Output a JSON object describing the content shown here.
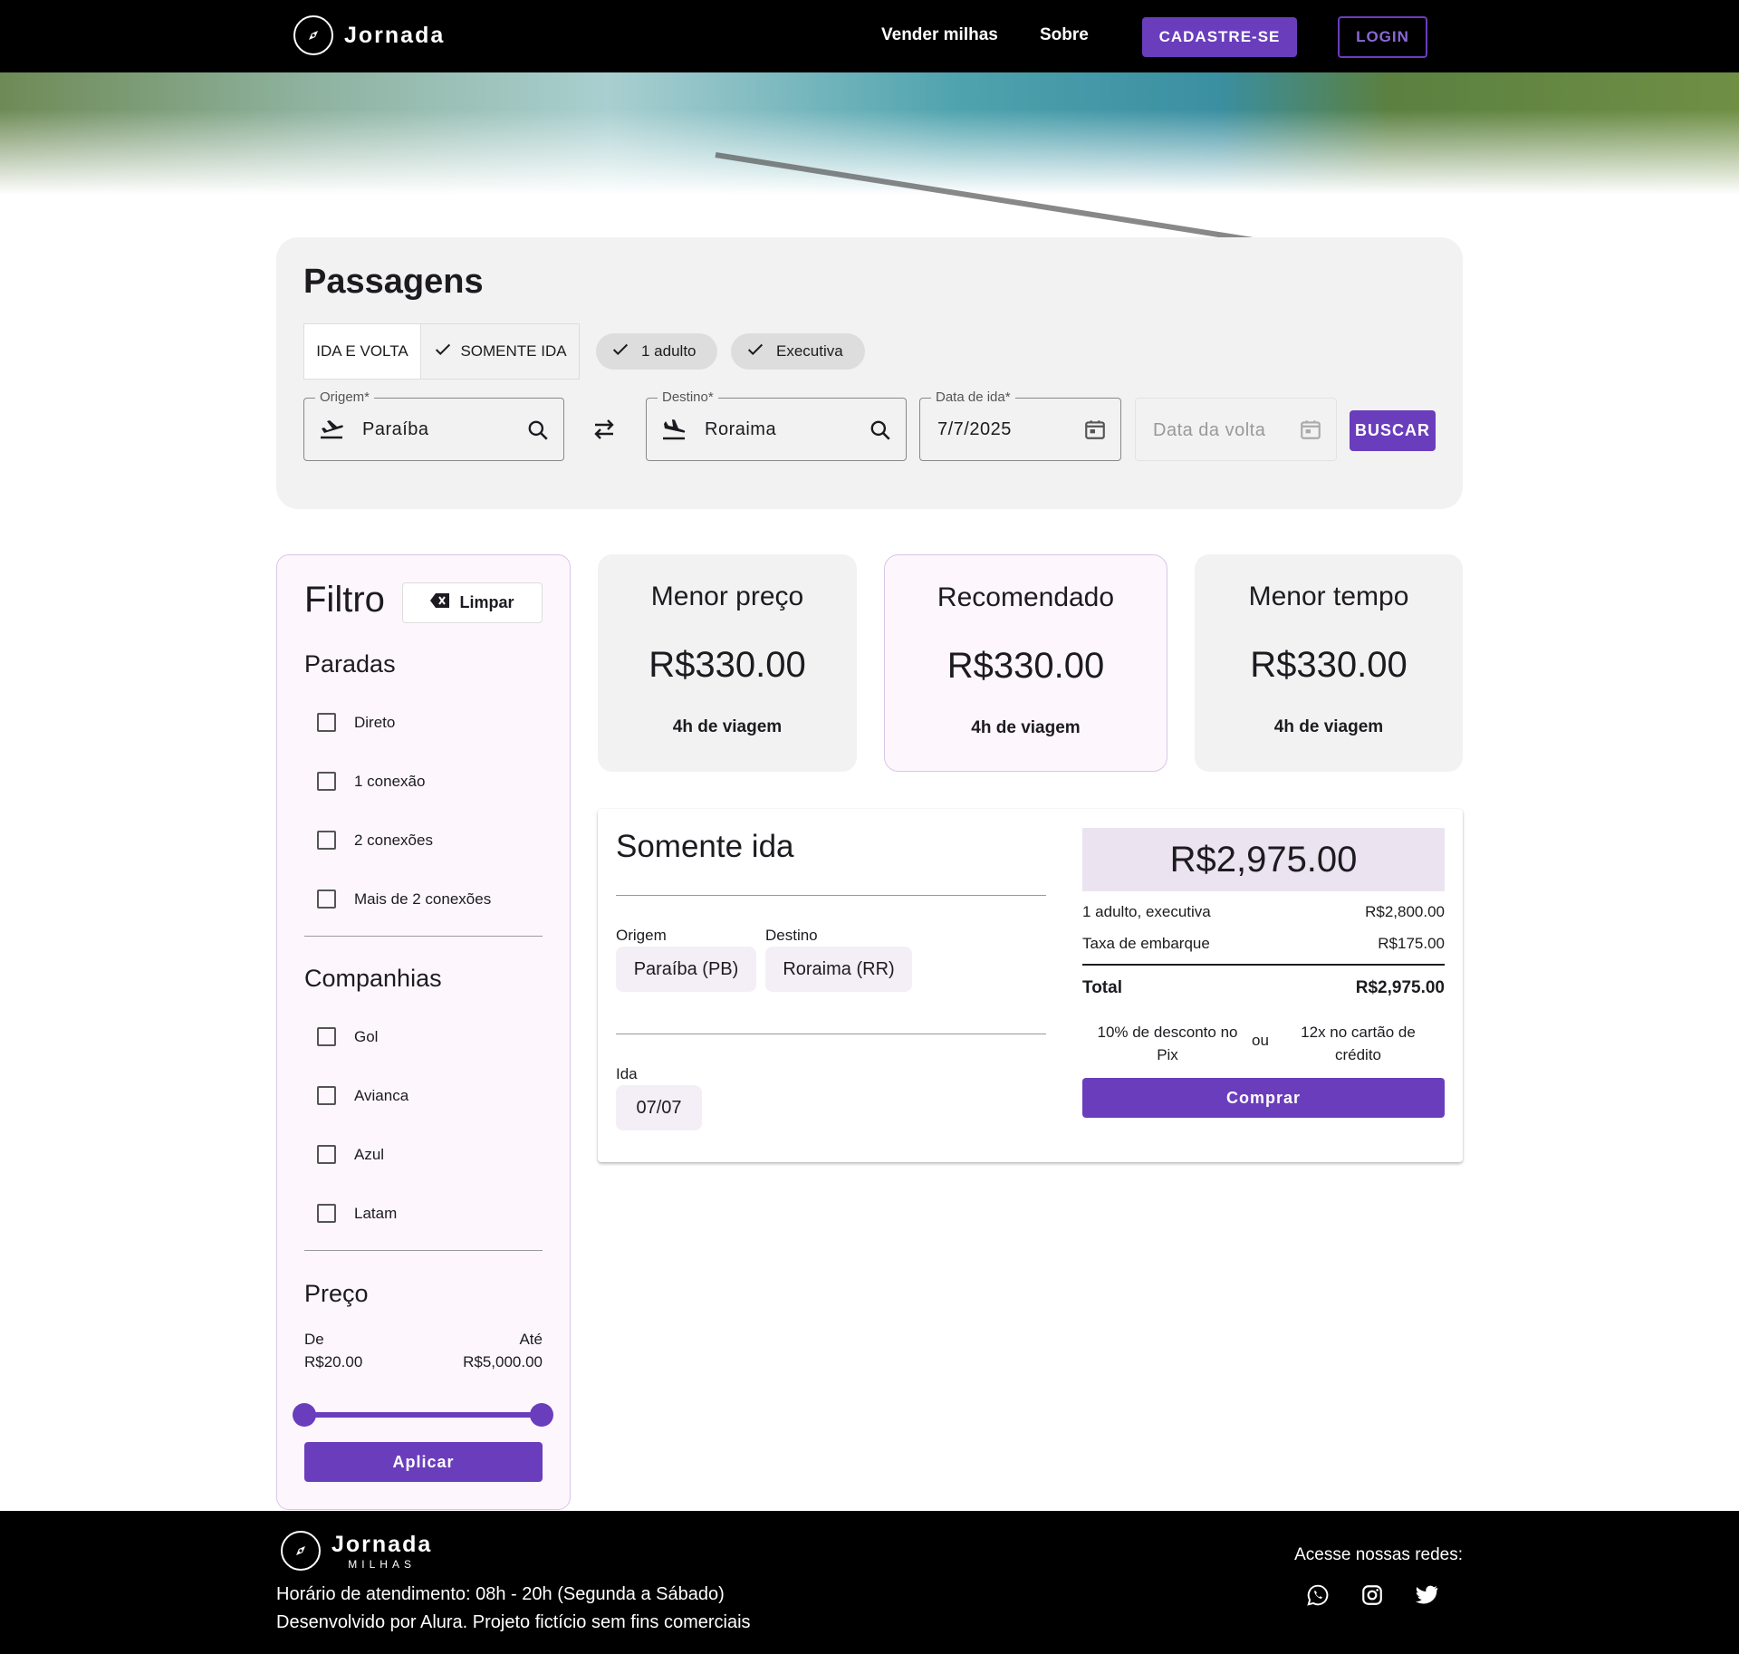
{
  "header": {
    "brand": "Jornada",
    "nav": {
      "sell_miles": "Vender milhas",
      "about": "Sobre"
    },
    "signup_label": "CADASTRE-SE",
    "login_label": "LOGIN"
  },
  "search": {
    "title": "Passagens",
    "trip_types": [
      "IDA E VOLTA",
      "SOMENTE IDA"
    ],
    "passengers_chip": "1 adulto",
    "class_chip": "Executiva",
    "origin": {
      "label": "Origem*",
      "value": "Paraíba"
    },
    "destination": {
      "label": "Destino*",
      "value": "Roraima"
    },
    "departure": {
      "label": "Data de ida*",
      "value": "7/7/2025"
    },
    "return": {
      "placeholder": "Data da volta"
    },
    "search_button": "BUSCAR"
  },
  "filter": {
    "title": "Filtro",
    "clear_label": "Limpar",
    "stops_title": "Paradas",
    "stops": [
      "Direto",
      "1 conexão",
      "2 conexões",
      "Mais de 2 conexões"
    ],
    "airlines_title": "Companhias",
    "airlines": [
      "Gol",
      "Avianca",
      "Azul",
      "Latam"
    ],
    "price_title": "Preço",
    "from_label": "De",
    "to_label": "Até",
    "min_price": "R$20.00",
    "max_price": "R$5,000.00",
    "apply_label": "Aplicar"
  },
  "summary_cards": [
    {
      "title": "Menor preço",
      "price": "R$330.00",
      "duration": "4h de viagem"
    },
    {
      "title": "Recomendado",
      "price": "R$330.00",
      "duration": "4h de viagem"
    },
    {
      "title": "Menor tempo",
      "price": "R$330.00",
      "duration": "4h de viagem"
    }
  ],
  "result": {
    "title": "Somente ida",
    "origin_label": "Origem",
    "origin": "Paraíba (PB)",
    "destination_label": "Destino",
    "destination": "Roraima (RR)",
    "departure_label": "Ida",
    "departure_date": "07/07",
    "total_price": "R$2,975.00",
    "line1_label": "1 adulto, executiva",
    "line1_value": "R$2,800.00",
    "line2_label": "Taxa de embarque",
    "line2_value": "R$175.00",
    "total_label": "Total",
    "total_value": "R$2,975.00",
    "pix_text": "10% de desconto no Pix",
    "or_text": "ou",
    "card_text": "12x no cartão de crédito",
    "buy_label": "Comprar"
  },
  "footer": {
    "brand": "Jornada",
    "brand_sub": "MILHAS",
    "hours": "Horário de atendimento: 08h - 20h (Segunda a Sábado)",
    "credits": "Desenvolvido por Alura. Projeto fictício sem fins comerciais",
    "social_title": "Acesse nossas redes:",
    "social_icons": [
      "whatsapp-icon",
      "instagram-icon",
      "twitter-icon"
    ]
  },
  "colors": {
    "primary": "#6a3dbd",
    "card_bg": "#f2f2f2",
    "filter_bg": "#fdf7fd"
  }
}
